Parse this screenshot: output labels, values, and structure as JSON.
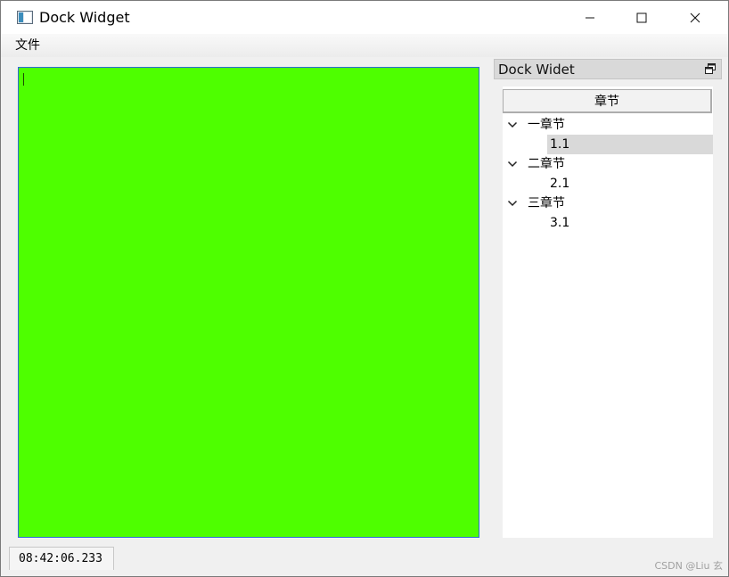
{
  "window": {
    "title": "Dock Widget",
    "icon": "app-window-icon",
    "controls": [
      "minimize-icon",
      "maximize-icon",
      "close-icon"
    ]
  },
  "menubar": {
    "items": [
      {
        "label": "文件"
      }
    ]
  },
  "editor": {
    "background": "#4eff00",
    "border_color": "#2d6ad6",
    "text": ""
  },
  "dock": {
    "title": "Dock Widet",
    "float_icon": "float-restore-icon",
    "tree": {
      "header": "章节",
      "items": [
        {
          "label": "一章节",
          "expanded": true,
          "children": [
            {
              "label": "1.1",
              "selected": true
            }
          ]
        },
        {
          "label": "二章节",
          "expanded": true,
          "children": [
            {
              "label": "2.1",
              "selected": false
            }
          ]
        },
        {
          "label": "三章节",
          "expanded": true,
          "children": [
            {
              "label": "3.1",
              "selected": false
            }
          ]
        }
      ]
    }
  },
  "statusbar": {
    "time": "08:42:06.233"
  },
  "watermark": "CSDN @Liu 玄"
}
